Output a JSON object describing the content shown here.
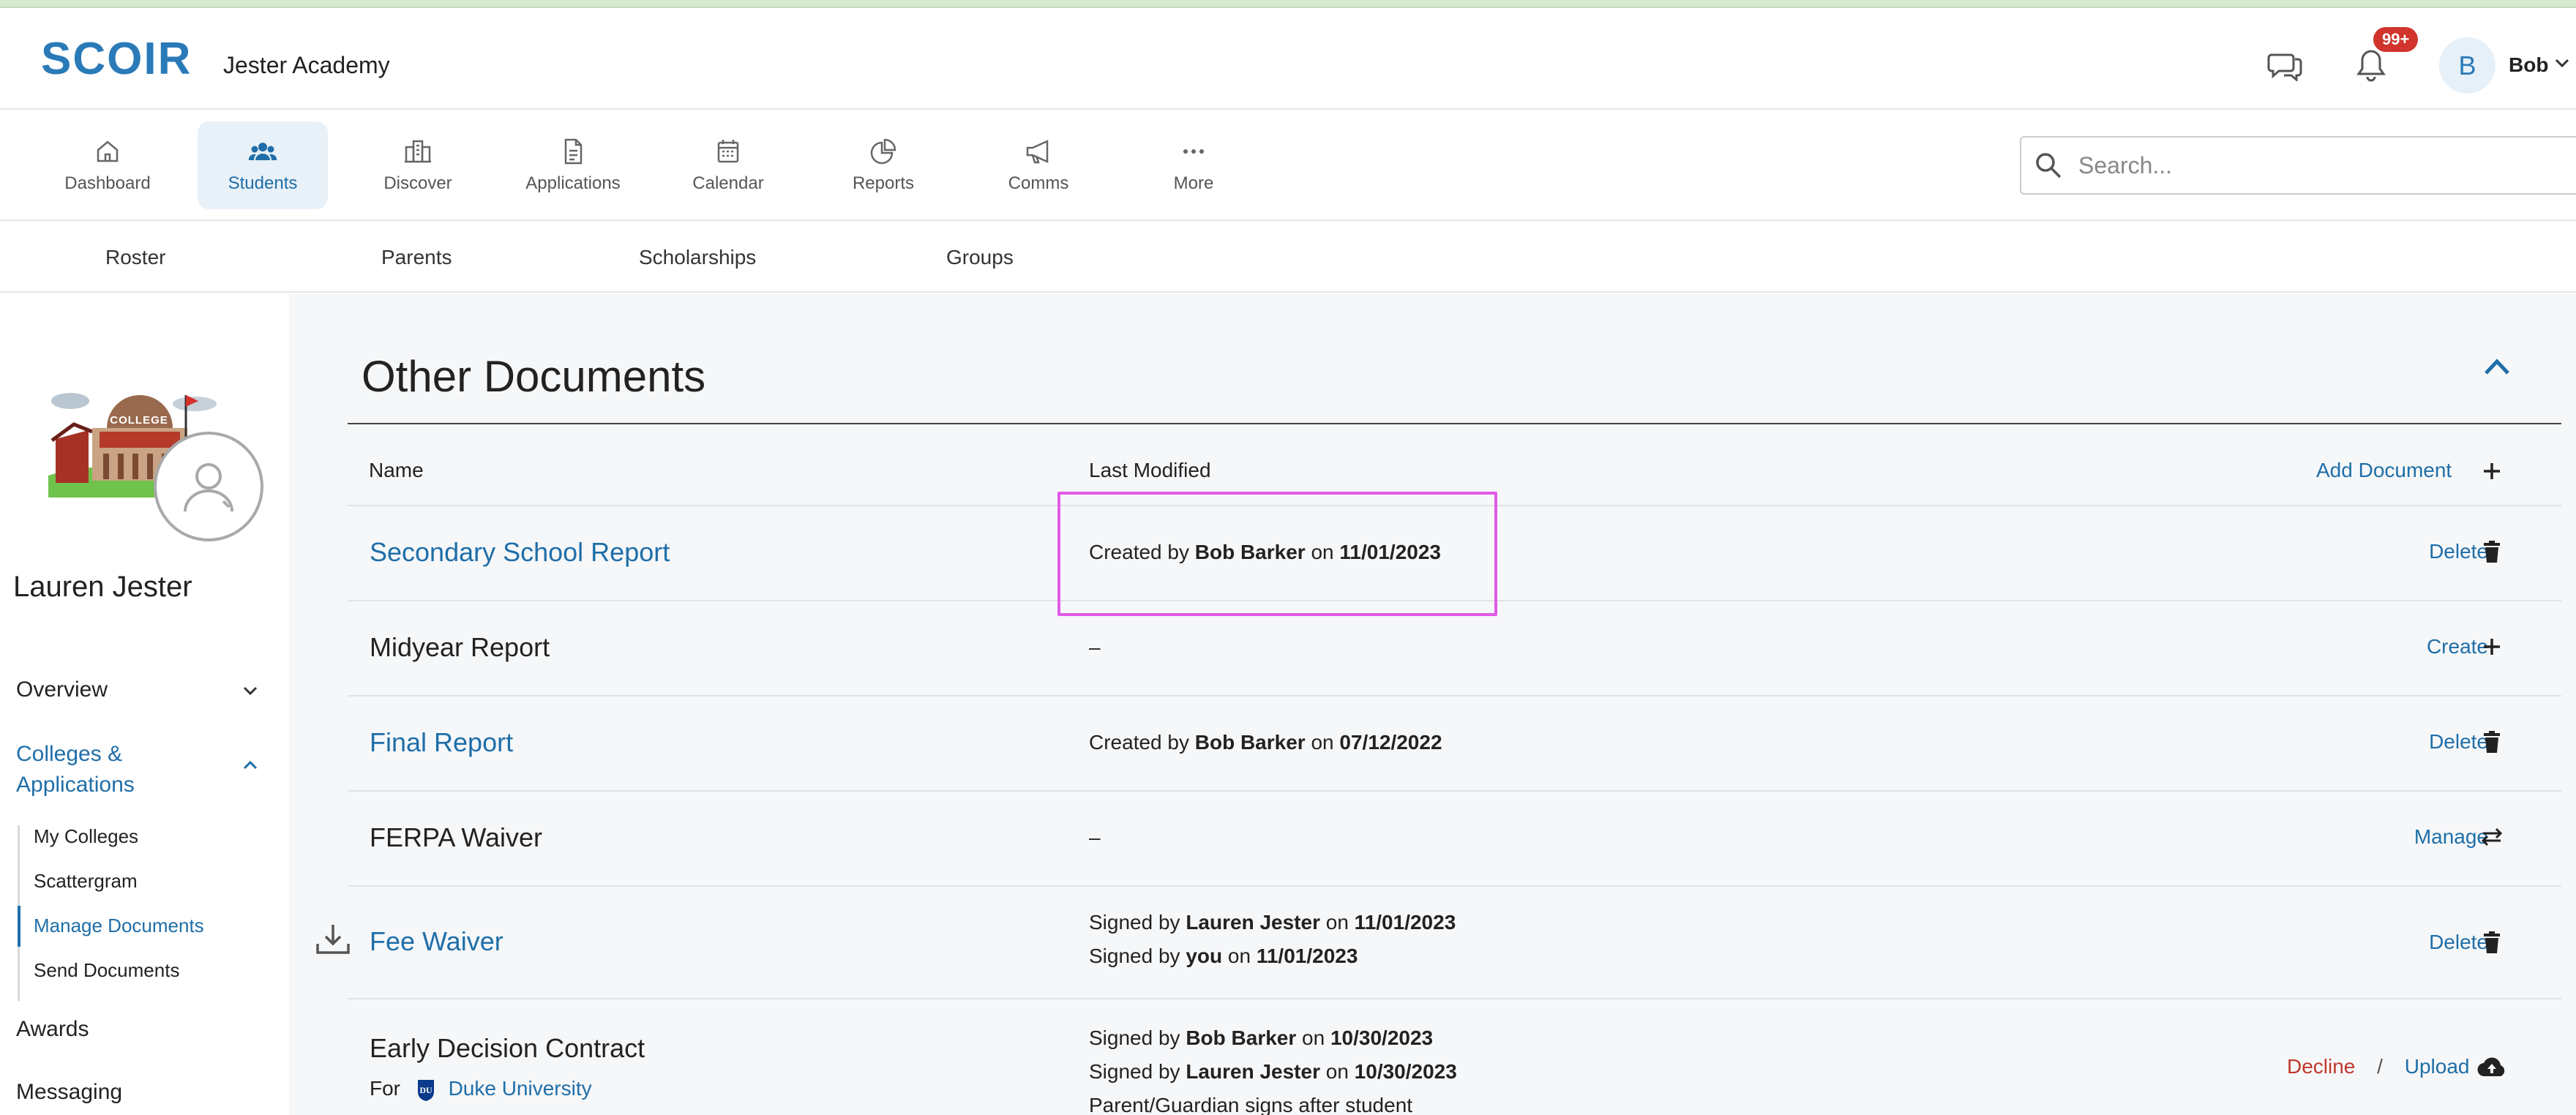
{
  "app": {
    "logo_text": "SCOIR",
    "school_name": "Jester Academy",
    "notification_count": "99+",
    "user_initial": "B",
    "user_name": "Bob",
    "accent_color": "#1f6ea8"
  },
  "nav": {
    "items": [
      {
        "label": "Dashboard",
        "icon": "home-icon"
      },
      {
        "label": "Students",
        "icon": "people-icon",
        "active": true
      },
      {
        "label": "Discover",
        "icon": "buildings-icon"
      },
      {
        "label": "Applications",
        "icon": "document-icon"
      },
      {
        "label": "Calendar",
        "icon": "calendar-icon"
      },
      {
        "label": "Reports",
        "icon": "pie-chart-icon"
      },
      {
        "label": "Comms",
        "icon": "megaphone-icon"
      },
      {
        "label": "More",
        "icon": "more-icon"
      }
    ],
    "search_placeholder": "Search..."
  },
  "subnav": {
    "items": [
      "Roster",
      "Parents",
      "Scholarships",
      "Groups"
    ]
  },
  "sidebar": {
    "student_name": "Lauren Jester",
    "illustration_text": "COLLEGE",
    "links": {
      "overview": "Overview",
      "colleges_line1": "Colleges &",
      "colleges_line2": "Applications",
      "awards": "Awards",
      "messaging": "Messaging"
    },
    "sub_links": [
      "My Colleges",
      "Scattergram",
      "Manage Documents",
      "Send Documents"
    ]
  },
  "main": {
    "title": "Other Documents",
    "columns": {
      "name": "Name",
      "last_modified": "Last Modified"
    },
    "add_document": "Add Document",
    "rows": [
      {
        "name": "Secondary School Report",
        "mod_prefix": "Created by ",
        "mod_person": "Bob Barker",
        "mod_mid": " on ",
        "mod_date": "11/01/2023",
        "action": "Delete",
        "icon": "trash-icon"
      },
      {
        "name": "Midyear Report",
        "mod_text": "–",
        "action": "Create",
        "icon": "plus-icon"
      },
      {
        "name": "Final Report",
        "mod_prefix": "Created by ",
        "mod_person": "Bob Barker",
        "mod_mid": " on ",
        "mod_date": "07/12/2022",
        "action": "Delete",
        "icon": "trash-icon"
      },
      {
        "name": "FERPA Waiver",
        "mod_text": "–",
        "action": "Manage",
        "icon": "swap-icon"
      },
      {
        "name": "Fee Waiver",
        "line1_prefix": "Signed by ",
        "line1_person": "Lauren Jester",
        "line1_mid": " on ",
        "line1_date": "11/01/2023",
        "line2_prefix": "Signed by ",
        "line2_person": "you",
        "line2_mid": " on ",
        "line2_date": "11/01/2023",
        "action": "Delete",
        "icon": "trash-icon"
      },
      {
        "name": "Early Decision Contract",
        "for_label": "For",
        "college": "Duke University",
        "line1_prefix": "Signed by ",
        "line1_person": "Bob Barker",
        "line1_mid": " on ",
        "line1_date": "10/30/2023",
        "line2_prefix": "Signed by ",
        "line2_person": "Lauren Jester",
        "line2_mid": " on ",
        "line2_date": "10/30/2023",
        "line3": "Parent/Guardian signs after student",
        "decline": "Decline",
        "separator": "/",
        "upload": "Upload",
        "icon": "cloud-upload-icon"
      }
    ]
  }
}
